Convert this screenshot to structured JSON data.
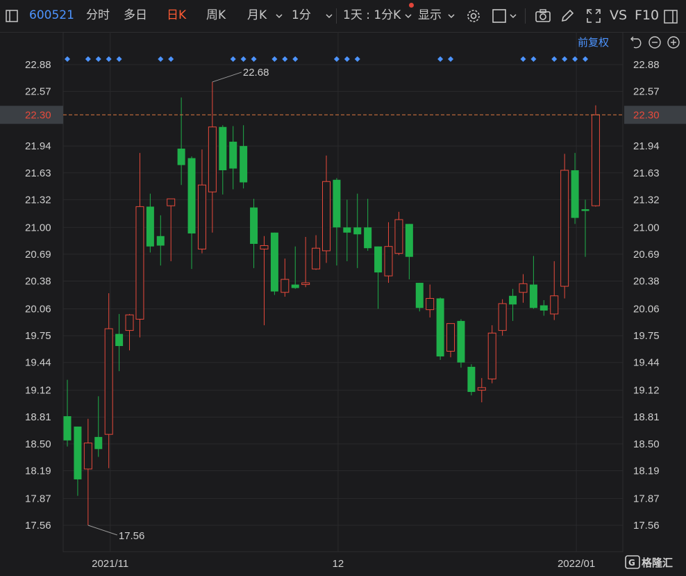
{
  "toolbar": {
    "stock_code": "600521",
    "tabs": [
      "分时",
      "多日",
      "日K",
      "周K",
      "月K"
    ],
    "active_tab": "日K",
    "interval": "1分",
    "range": "1天 : 1分K",
    "display": "显示",
    "right_labels": {
      "vs": "VS",
      "f10": "F10"
    }
  },
  "subheader": {
    "adjust": "前复权"
  },
  "branding": {
    "logo_text": "格隆汇"
  },
  "colors": {
    "up": "#e84a3c",
    "down": "#1fb04a",
    "price_line": "#e07b42",
    "accent": "#4d94ff"
  },
  "chart_data": {
    "type": "candlestick",
    "ylim": [
      17.41,
      23.03
    ],
    "y_ticks": [
      "22.88",
      "22.57",
      "21.94",
      "21.63",
      "21.32",
      "21.00",
      "20.69",
      "20.38",
      "20.06",
      "19.75",
      "19.44",
      "19.12",
      "18.81",
      "18.50",
      "18.19",
      "17.87",
      "17.56"
    ],
    "x_labels": [
      {
        "label": "2021/11",
        "index": 4
      },
      {
        "label": "12",
        "index": 26
      },
      {
        "label": "2022/01",
        "index": 49
      }
    ],
    "current_price": "22.30",
    "annotations": {
      "high": "22.68",
      "low": "17.56"
    },
    "marker_indices": [
      0,
      2,
      3,
      4,
      5,
      9,
      10,
      16,
      17,
      18,
      20,
      21,
      22,
      26,
      27,
      28,
      36,
      37,
      44,
      45,
      47,
      48,
      49,
      50
    ],
    "candles": [
      {
        "o": 18.82,
        "h": 19.24,
        "l": 18.47,
        "c": 18.54
      },
      {
        "o": 18.7,
        "h": 18.7,
        "l": 17.9,
        "c": 18.09
      },
      {
        "o": 18.21,
        "h": 18.79,
        "l": 17.56,
        "c": 18.51
      },
      {
        "o": 18.58,
        "h": 19.05,
        "l": 18.35,
        "c": 18.44
      },
      {
        "o": 18.61,
        "h": 20.24,
        "l": 18.22,
        "c": 19.83
      },
      {
        "o": 19.77,
        "h": 20.0,
        "l": 19.34,
        "c": 19.63
      },
      {
        "o": 19.81,
        "h": 20.0,
        "l": 19.58,
        "c": 19.99
      },
      {
        "o": 19.94,
        "h": 21.86,
        "l": 19.73,
        "c": 21.24
      },
      {
        "o": 21.24,
        "h": 21.39,
        "l": 20.71,
        "c": 20.78
      },
      {
        "o": 20.9,
        "h": 21.14,
        "l": 20.56,
        "c": 20.79
      },
      {
        "o": 21.25,
        "h": 21.33,
        "l": 20.61,
        "c": 21.33
      },
      {
        "o": 21.91,
        "h": 22.5,
        "l": 21.49,
        "c": 21.72
      },
      {
        "o": 21.8,
        "h": 21.82,
        "l": 20.52,
        "c": 20.93
      },
      {
        "o": 20.75,
        "h": 21.9,
        "l": 20.7,
        "c": 21.49
      },
      {
        "o": 21.41,
        "h": 22.68,
        "l": 20.94,
        "c": 22.16
      },
      {
        "o": 22.16,
        "h": 22.18,
        "l": 21.38,
        "c": 21.66
      },
      {
        "o": 21.99,
        "h": 22.17,
        "l": 21.44,
        "c": 21.68
      },
      {
        "o": 21.94,
        "h": 22.18,
        "l": 21.45,
        "c": 21.52
      },
      {
        "o": 21.23,
        "h": 21.33,
        "l": 20.53,
        "c": 20.81
      },
      {
        "o": 20.75,
        "h": 20.9,
        "l": 19.87,
        "c": 20.79
      },
      {
        "o": 20.94,
        "h": 20.94,
        "l": 20.22,
        "c": 20.26
      },
      {
        "o": 20.25,
        "h": 20.64,
        "l": 20.2,
        "c": 20.4
      },
      {
        "o": 20.34,
        "h": 20.78,
        "l": 20.29,
        "c": 20.3
      },
      {
        "o": 20.34,
        "h": 20.89,
        "l": 20.31,
        "c": 20.36
      },
      {
        "o": 20.52,
        "h": 20.91,
        "l": 20.51,
        "c": 20.76
      },
      {
        "o": 20.73,
        "h": 21.83,
        "l": 20.59,
        "c": 21.53
      },
      {
        "o": 21.55,
        "h": 21.57,
        "l": 20.56,
        "c": 21.0
      },
      {
        "o": 21.0,
        "h": 21.32,
        "l": 20.61,
        "c": 20.94
      },
      {
        "o": 21.0,
        "h": 21.39,
        "l": 20.53,
        "c": 20.92
      },
      {
        "o": 21.0,
        "h": 21.33,
        "l": 20.73,
        "c": 20.76
      },
      {
        "o": 20.78,
        "h": 20.78,
        "l": 20.06,
        "c": 20.48
      },
      {
        "o": 20.44,
        "h": 21.06,
        "l": 20.36,
        "c": 20.78
      },
      {
        "o": 20.7,
        "h": 21.18,
        "l": 20.68,
        "c": 21.09
      },
      {
        "o": 21.04,
        "h": 21.04,
        "l": 20.4,
        "c": 20.66
      },
      {
        "o": 20.36,
        "h": 20.36,
        "l": 20.03,
        "c": 20.07
      },
      {
        "o": 20.05,
        "h": 20.34,
        "l": 19.96,
        "c": 20.18
      },
      {
        "o": 20.18,
        "h": 20.19,
        "l": 19.47,
        "c": 19.51
      },
      {
        "o": 19.57,
        "h": 19.84,
        "l": 19.5,
        "c": 19.89
      },
      {
        "o": 19.92,
        "h": 19.94,
        "l": 19.38,
        "c": 19.44
      },
      {
        "o": 19.39,
        "h": 19.42,
        "l": 19.06,
        "c": 19.1
      },
      {
        "o": 19.12,
        "h": 19.26,
        "l": 18.98,
        "c": 19.15
      },
      {
        "o": 19.25,
        "h": 19.87,
        "l": 19.2,
        "c": 19.78
      },
      {
        "o": 19.81,
        "h": 20.17,
        "l": 19.75,
        "c": 20.12
      },
      {
        "o": 20.21,
        "h": 20.29,
        "l": 19.92,
        "c": 20.11
      },
      {
        "o": 20.25,
        "h": 20.46,
        "l": 20.13,
        "c": 20.35
      },
      {
        "o": 20.34,
        "h": 20.67,
        "l": 20.06,
        "c": 20.07
      },
      {
        "o": 20.1,
        "h": 20.16,
        "l": 19.98,
        "c": 20.04
      },
      {
        "o": 20.0,
        "h": 20.61,
        "l": 19.93,
        "c": 20.21
      },
      {
        "o": 20.32,
        "h": 21.85,
        "l": 20.18,
        "c": 21.66
      },
      {
        "o": 21.66,
        "h": 21.86,
        "l": 21.04,
        "c": 21.11
      },
      {
        "o": 21.21,
        "h": 21.32,
        "l": 20.66,
        "c": 21.19
      },
      {
        "o": 21.25,
        "h": 22.41,
        "l": 21.24,
        "c": 22.3
      }
    ]
  }
}
